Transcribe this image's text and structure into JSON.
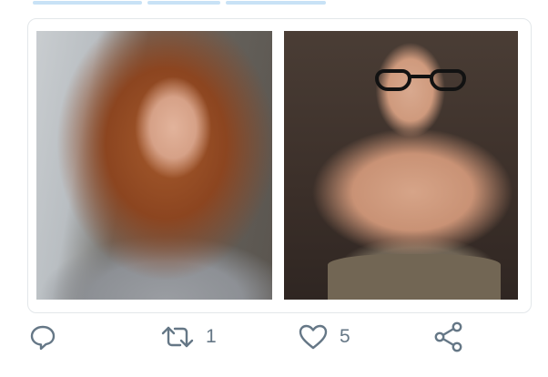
{
  "tweet": {
    "media": {
      "photos": [
        {
          "label": "photo-left"
        },
        {
          "label": "photo-right"
        }
      ]
    },
    "actions": {
      "reply_icon": "speech-bubble-icon",
      "retweet_icon": "retweet-arrows-icon",
      "retweet_count": "1",
      "like_icon": "heart-icon",
      "like_count": "5",
      "share_icon": "share-nodes-icon"
    },
    "colors": {
      "icon_gray": "#657786",
      "link_blue": "#1da1f2",
      "card_border": "#e3e7ea"
    }
  }
}
